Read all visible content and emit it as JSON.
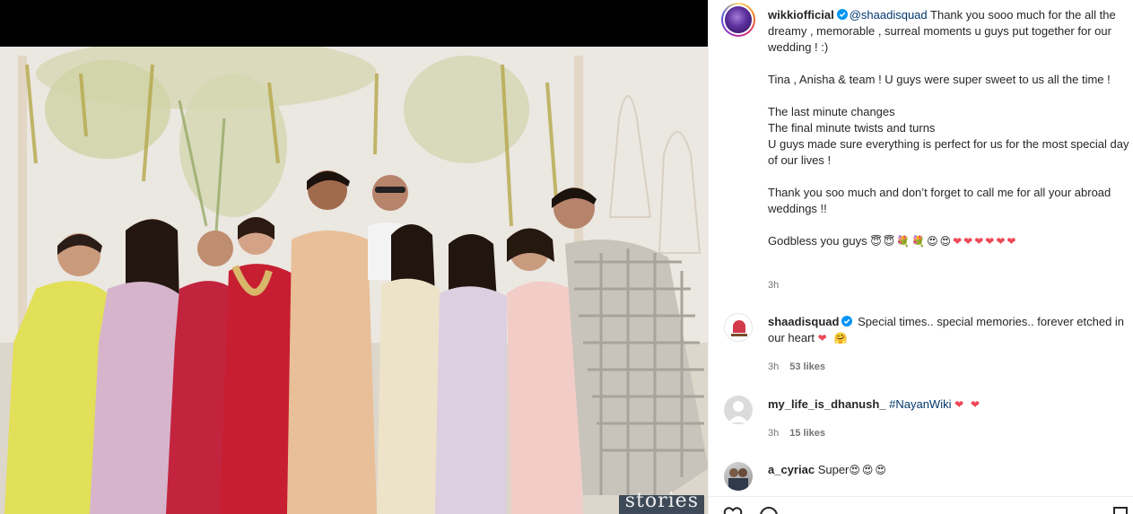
{
  "post": {
    "watermark": "stories"
  },
  "caption": {
    "username": "wikkiofficial",
    "mention": "@shaadisquad",
    "line1": " Thank you sooo much for the all the dreamy , memorable , surreal moments u guys put together for our wedding ! :)",
    "line2": "Tina , Anisha & team ! U guys were super sweet to us all the time !",
    "line3a": "The last minute changes",
    "line3b": "The final minute twists and turns",
    "line3c": "U guys made sure everything is perfect for us for the most special day of our lives !",
    "line4": "Thank you soo much and don’t forget to call me for all your abroad weddings !!",
    "line5": "Godbless you guys",
    "line5_emojis": "😇😇💐💐😍😍",
    "line5_hearts": "❤❤❤❤❤❤",
    "time": "3h"
  },
  "comments": [
    {
      "username": "shaadisquad",
      "text": " Special times.. special memories.. forever etched in our heart ",
      "emojis": "❤ 🤗",
      "time": "3h",
      "likes": "53 likes"
    },
    {
      "username": "my_life_is_dhanush_",
      "hashtag": "#NayanWiki",
      "emojis": "❤ ❤",
      "time": "3h",
      "likes": "15 likes"
    },
    {
      "username": "a_cyriac",
      "text": "Super",
      "emojis": "😍😍😍"
    }
  ],
  "colors": {
    "link": "#00376b",
    "verified": "#0095f6",
    "heart": "#ed4956",
    "muted": "#737373"
  }
}
